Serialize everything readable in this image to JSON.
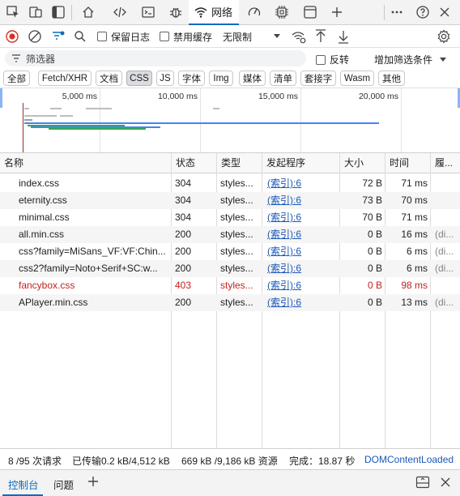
{
  "tabs": {
    "network_label": "网络"
  },
  "toolbar": {
    "preserve_log": "保留日志",
    "disable_cache": "禁用缓存",
    "throttle": "无限制"
  },
  "filter": {
    "placeholder": "筛选器",
    "invert": "反转",
    "more_filters": "增加筛选条件"
  },
  "types": [
    "全部",
    "Fetch/XHR",
    "文档",
    "CSS",
    "JS",
    "字体",
    "Img",
    "媒体",
    "清单",
    "套接字",
    "Wasm",
    "其他"
  ],
  "active_type": "CSS",
  "overview": {
    "ticks": [
      "5,000 ms",
      "10,000 ms",
      "15,000 ms",
      "20,000 ms"
    ]
  },
  "table": {
    "headers": [
      "名称",
      "状态",
      "类型",
      "发起程序",
      "大小",
      "时间",
      "履..."
    ],
    "rows": [
      {
        "name": "index.css",
        "status": "304",
        "type": "styles...",
        "initiator": "(索引):6",
        "size": "72 B",
        "time": "71 ms",
        "extra": ""
      },
      {
        "name": "eternity.css",
        "status": "304",
        "type": "styles...",
        "initiator": "(索引):6",
        "size": "73 B",
        "time": "70 ms",
        "extra": ""
      },
      {
        "name": "minimal.css",
        "status": "304",
        "type": "styles...",
        "initiator": "(索引):6",
        "size": "70 B",
        "time": "71 ms",
        "extra": ""
      },
      {
        "name": "all.min.css",
        "status": "200",
        "type": "styles...",
        "initiator": "(索引):6",
        "size": "0 B",
        "time": "16 ms",
        "extra": "(di..."
      },
      {
        "name": "css?family=MiSans_VF:VF:Chin...",
        "status": "200",
        "type": "styles...",
        "initiator": "(索引):6",
        "size": "0 B",
        "time": "6 ms",
        "extra": "(di..."
      },
      {
        "name": "css2?family=Noto+Serif+SC:w...",
        "status": "200",
        "type": "styles...",
        "initiator": "(索引):6",
        "size": "0 B",
        "time": "6 ms",
        "extra": "(di..."
      },
      {
        "name": "fancybox.css",
        "status": "403",
        "type": "styles...",
        "initiator": "(索引):6",
        "size": "0 B",
        "time": "98 ms",
        "extra": "",
        "error": true
      },
      {
        "name": "APlayer.min.css",
        "status": "200",
        "type": "styles...",
        "initiator": "(索引):6",
        "size": "0 B",
        "time": "13 ms",
        "extra": "(di..."
      }
    ]
  },
  "status": {
    "requests": "8 /95 次请求",
    "transferred": "已传输0.2 kB/4,512 kB",
    "resources": "669 kB /9,186 kB 资源",
    "finish": "完成：18.87 秒",
    "dom": "DOMContentLoaded"
  },
  "drawer": {
    "console": "控制台",
    "issues": "问题"
  },
  "colors": {
    "accent": "#0f6cbd",
    "error": "#c5221f",
    "link": "#1a58b8"
  }
}
